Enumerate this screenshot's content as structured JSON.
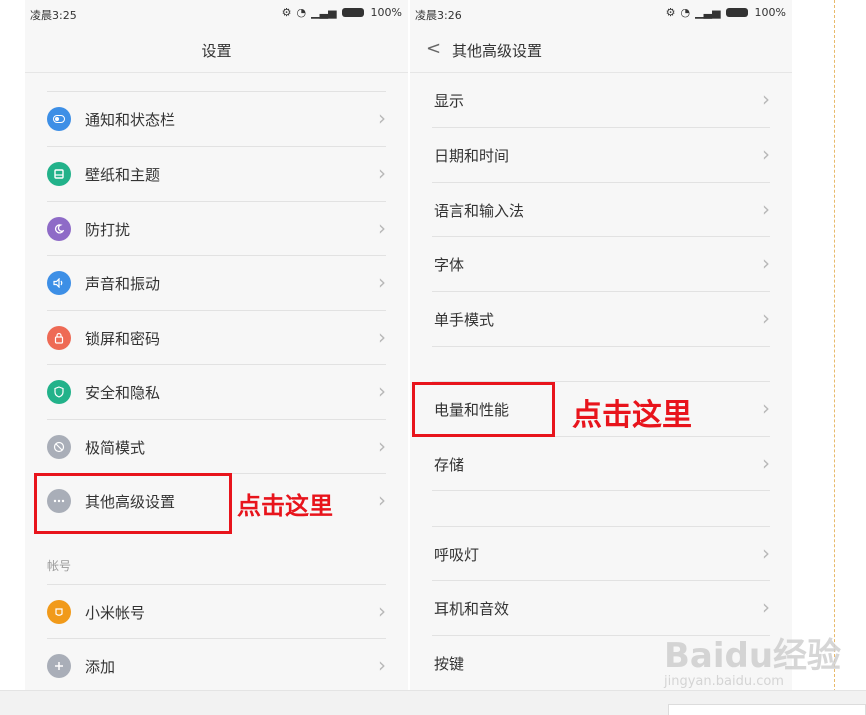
{
  "colors": {
    "accent_red": "#e8141c",
    "icon_blue": "#3d8fe6",
    "icon_teal": "#22b28a",
    "icon_purple": "#8e6bc7",
    "icon_coral": "#ee6a55",
    "icon_gray": "#a9aeb8",
    "icon_orange": "#f19a1a"
  },
  "left_phone": {
    "status": {
      "time": "凌晨3:25",
      "battery": "100%"
    },
    "title": "设置",
    "items": [
      {
        "label": "通知和状态栏",
        "icon": "notification-toggle-icon"
      },
      {
        "label": "壁纸和主题",
        "icon": "wallpaper-icon"
      },
      {
        "label": "防打扰",
        "icon": "moon-icon"
      },
      {
        "label": "声音和振动",
        "icon": "speaker-icon"
      },
      {
        "label": "锁屏和密码",
        "icon": "lock-icon"
      },
      {
        "label": "安全和隐私",
        "icon": "shield-icon"
      },
      {
        "label": "极简模式",
        "icon": "no-entry-icon"
      },
      {
        "label": "其他高级设置",
        "icon": "more-dots-icon"
      }
    ],
    "section_label": "帐号",
    "account_items": [
      {
        "label": "小米帐号",
        "icon": "mi-account-icon"
      },
      {
        "label": "添加",
        "icon": "plus-icon"
      }
    ],
    "callout": "点击这里"
  },
  "right_phone": {
    "status": {
      "time": "凌晨3:26",
      "battery": "100%"
    },
    "back_label": "<",
    "title": "其他高级设置",
    "items": [
      {
        "label": "显示"
      },
      {
        "label": "日期和时间"
      },
      {
        "label": "语言和输入法"
      },
      {
        "label": "字体"
      },
      {
        "label": "单手模式"
      },
      {
        "label": "电量和性能"
      },
      {
        "label": "存储"
      },
      {
        "label": "呼吸灯"
      },
      {
        "label": "耳机和音效"
      },
      {
        "label": "按键"
      }
    ],
    "callout": "点击这里"
  },
  "watermark": {
    "brand": "Baidu经验",
    "url": "jingyan.baidu.com"
  }
}
